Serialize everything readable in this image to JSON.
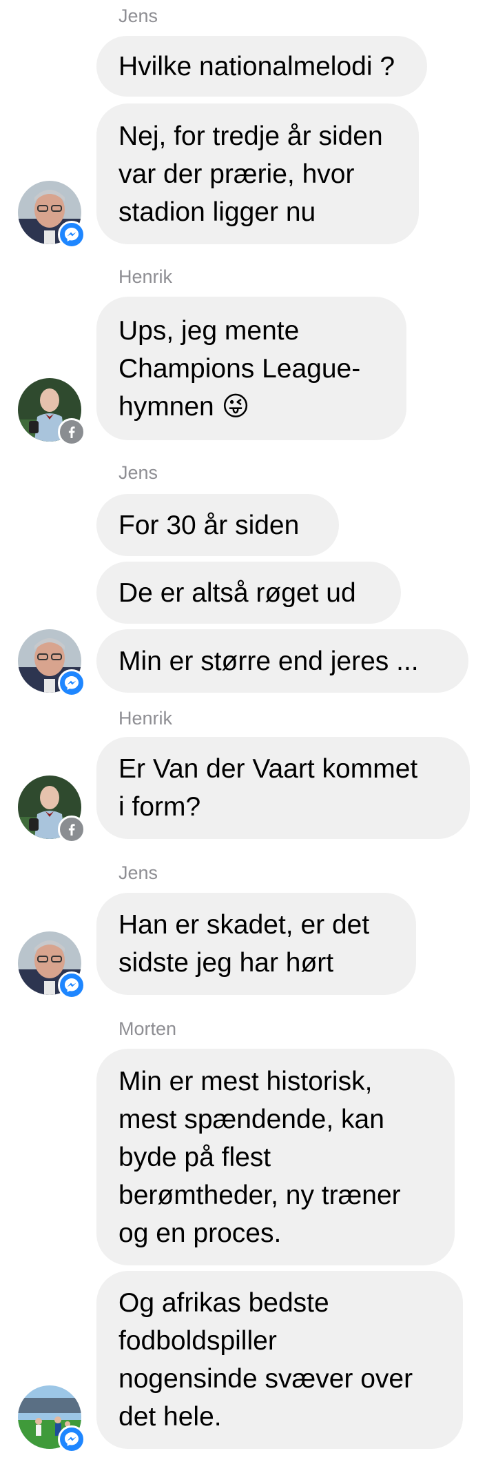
{
  "chat": {
    "groups": [
      {
        "sender": "Jens",
        "messages": [
          "Hvilke nationalmelodi ?",
          "Nej, for tredje år siden\nvar der prærie, hvor\nstadion ligger nu"
        ]
      },
      {
        "sender": "Henrik",
        "messages": [
          "Ups, jeg mente\nChampions League-\nhymnen 😜"
        ]
      },
      {
        "sender": "Jens",
        "messages": [
          "For 30 år siden",
          "De er altså røget ud",
          "Min er større end jeres ..."
        ]
      },
      {
        "sender": "Henrik",
        "messages": [
          "Er Van der Vaart kommet\ni form?"
        ]
      },
      {
        "sender": "Jens",
        "messages": [
          "Han er skadet, er det\nsidste jeg har hørt"
        ]
      },
      {
        "sender": "Morten",
        "messages": [
          "Min er mest historisk,\nmest spændende, kan\nbyde på flest\nberømtheder, ny træner\nog en proces.",
          "Og afrikas bedste\nfodboldspiller\nnogensinde svæver over\ndet hele."
        ]
      }
    ]
  },
  "colors": {
    "bubble": "#f0f0f0",
    "sender_label": "#8e8e93",
    "messenger_badge": "#1e86ff",
    "facebook_badge": "#8a8d91"
  },
  "icons": {
    "messenger_badge": "messenger-icon",
    "facebook_badge": "facebook-icon"
  }
}
